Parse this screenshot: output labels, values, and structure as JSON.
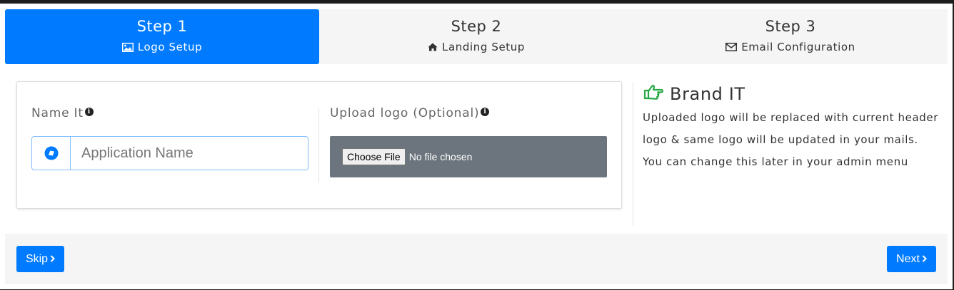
{
  "steps": [
    {
      "title": "Step 1",
      "subtitle": "Logo Setup",
      "icon": "image-icon",
      "active": true
    },
    {
      "title": "Step 2",
      "subtitle": "Landing Setup",
      "icon": "home-icon",
      "active": false
    },
    {
      "title": "Step 3",
      "subtitle": "Email Configuration",
      "icon": "envelope-icon",
      "active": false
    }
  ],
  "form": {
    "name_label": "Name It",
    "name_placeholder": "Application Name",
    "name_value": "",
    "upload_label": "Upload logo (Optional)",
    "file_button": "Choose File",
    "file_status": "No file chosen"
  },
  "brand": {
    "title": "Brand IT",
    "text_lines": [
      "Uploaded logo will be replaced with current header",
      "logo & same logo will be updated in your mails.",
      "You can change this later in your admin menu"
    ]
  },
  "footer": {
    "skip_label": "Skip",
    "next_label": "Next"
  },
  "colors": {
    "primary": "#007bff",
    "brand_icon": "#28a745",
    "file_bg": "#6c757d"
  }
}
